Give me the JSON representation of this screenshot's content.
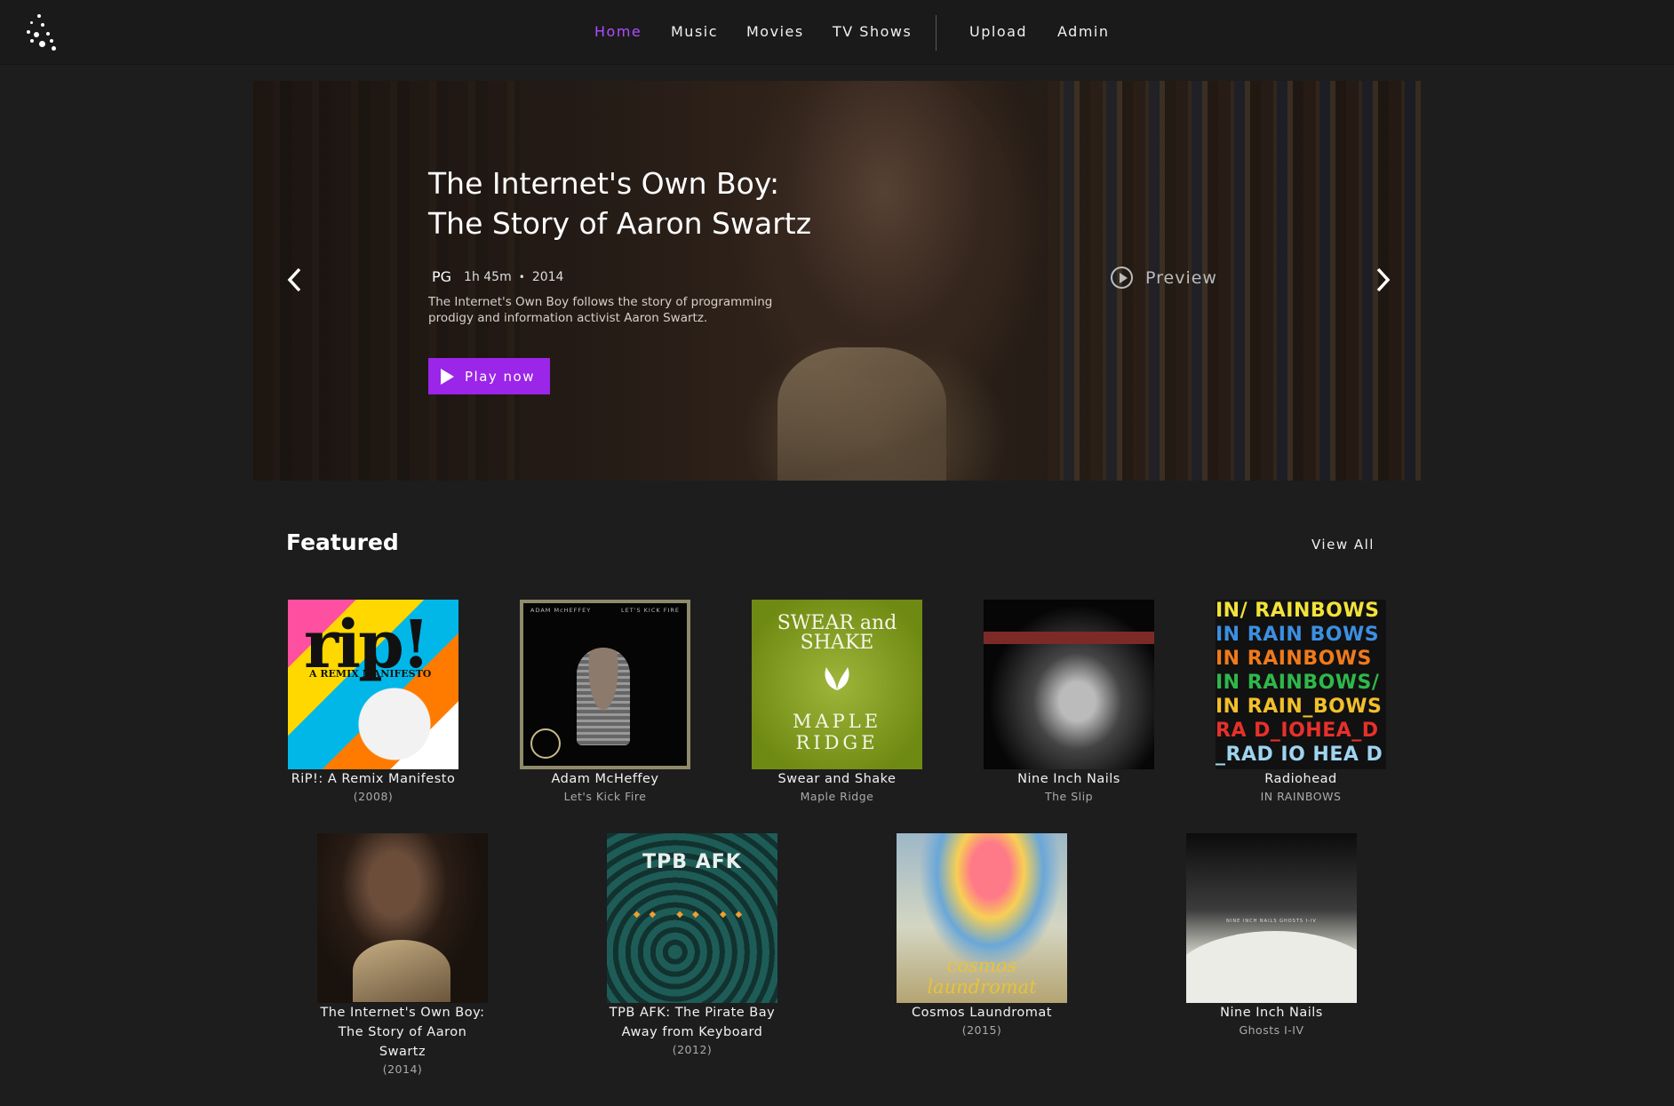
{
  "nav": {
    "items": [
      "Home",
      "Music",
      "Movies",
      "TV Shows"
    ],
    "admin_items": [
      "Upload",
      "Admin"
    ],
    "active": "Home",
    "accent_color": "#b04dff"
  },
  "hero": {
    "title_line1": "The Internet's Own Boy:",
    "title_line2": "The Story of Aaron Swartz",
    "rating": "PG",
    "duration": "1h 45m",
    "separator": "•",
    "year": "2014",
    "description": "The Internet's Own Boy follows the story of programming prodigy and information activist Aaron Swartz.",
    "play_label": "Play now",
    "preview_label": "Preview",
    "play_color": "#9b25e8"
  },
  "featured": {
    "title": "Featured",
    "view_all": "View All",
    "items": [
      {
        "title": "RiP!: A Remix Manifesto",
        "sub": "(2008)"
      },
      {
        "title": "Adam McHeffey",
        "sub": "Let's Kick Fire"
      },
      {
        "title": "Swear and Shake",
        "sub": "Maple Ridge"
      },
      {
        "title": "Nine Inch Nails",
        "sub": "The Slip"
      },
      {
        "title": "Radiohead",
        "sub": "IN RAINBOWS"
      },
      {
        "title": "The Internet's Own Boy: The Story of Aaron Swartz",
        "sub": "(2014)"
      },
      {
        "title": "TPB AFK: The Pirate Bay Away from Keyboard",
        "sub": "(2012)"
      },
      {
        "title": "Cosmos Laundromat",
        "sub": "(2015)"
      },
      {
        "title": "Nine Inch Nails",
        "sub": "Ghosts I-IV"
      }
    ]
  },
  "covers": {
    "rip_big": "rip!",
    "rip_sub": "A REMIX MANIFESTO",
    "adam_hdr_left": "ADAM McHEFFEY",
    "adam_hdr_right": "LET'S KICK FIRE",
    "swear_top": "SWEAR and SHAKE",
    "swear_bottom_1": "MAPLE",
    "swear_bottom_2": "RIDGE",
    "radiohead_rows": [
      "IN/ RAINBOWS",
      "IN RAIN BOWS",
      "IN RAINBOWS",
      "IN RAINBOWS/",
      "IN RAIN_BOWS",
      "RA D_IOHEA_D",
      "_RAD IO HEA D"
    ],
    "tpb_logo": "TPB AFK",
    "cosmos_text": "cosmos laundromat",
    "ghosts_text": "NINE INCH NAILS GHOSTS I-IV"
  }
}
